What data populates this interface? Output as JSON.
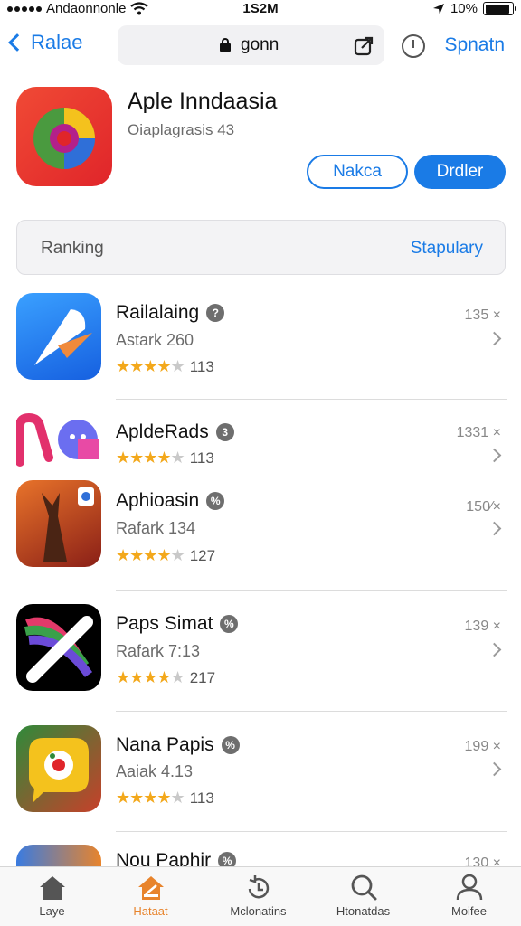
{
  "status_bar": {
    "carrier": "Andaonnonle",
    "time": "1S2M",
    "battery": "10%",
    "battery_level": 0.9
  },
  "nav": {
    "back_label": "Ralae",
    "url": "gonn",
    "right_link": "Spnatn"
  },
  "app": {
    "title": "Aple Inndaasia",
    "subtitle": "Oiaplagrasis 43",
    "button_outline": "Nakca",
    "button_primary": "Drdler"
  },
  "segment": {
    "left": "Ranking",
    "right": "Stapulary"
  },
  "list": [
    {
      "name": "Railalaing",
      "badge": "?",
      "subtitle": "Astark 260",
      "stars": 4,
      "rating_count": "113",
      "meta": "135 ×"
    },
    {
      "name": "ApldeRads",
      "badge": "3",
      "subtitle": "",
      "stars": 4,
      "rating_count": "113",
      "meta": "1331 ×"
    },
    {
      "name": "Aphioasin",
      "badge": "%",
      "subtitle": "Rafark 134",
      "stars": 4,
      "rating_count": "127",
      "meta": "150⁄×"
    },
    {
      "name": "Paps Simat",
      "badge": "%",
      "subtitle": "Rafark 7:13",
      "stars": 4,
      "rating_count": "217",
      "meta": "139 ×"
    },
    {
      "name": "Nana Papis",
      "badge": "%",
      "subtitle": "Aaiak 4.13",
      "stars": 4,
      "rating_count": "113",
      "meta": "199 ×"
    },
    {
      "name": "Nou Paphir",
      "badge": "%",
      "subtitle": "",
      "stars": 0,
      "rating_count": "",
      "meta": "130 ×"
    }
  ],
  "tabs": [
    {
      "label": "Laye",
      "icon": "home-icon",
      "active": false
    },
    {
      "label": "Hataat",
      "icon": "featured-home-icon",
      "active": true
    },
    {
      "label": "Mclonatins",
      "icon": "updates-icon",
      "active": false
    },
    {
      "label": "Htonatdas",
      "icon": "search-icon",
      "active": false
    },
    {
      "label": "Moifee",
      "icon": "profile-icon",
      "active": false
    }
  ],
  "colors": {
    "accent": "#1a7be6",
    "star": "#f3a81b",
    "active_tab": "#e8842c"
  }
}
